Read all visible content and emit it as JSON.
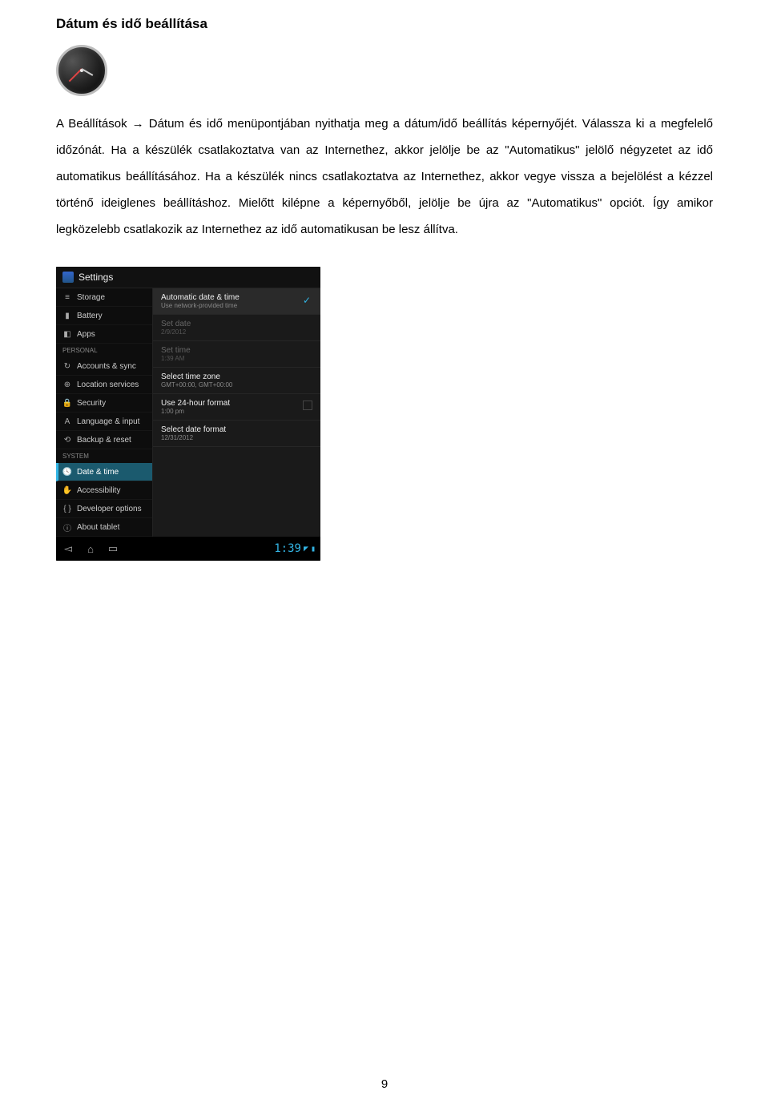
{
  "heading": "Dátum és idő beállítása",
  "body_text": "A Beállítások → Dátum és idő menüpontjában nyithatja meg a dátum/idő beállítás képernyőjét. Válassza ki a megfelelő időzónát. Ha a készülék csatlakoztatva van az Internethez, akkor jelölje be az \"Automatikus\" jelölő négyzetet az idő automatikus beállításához. Ha a készülék nincs csatlakoztatva az Internethez, akkor vegye vissza a bejelölést a kézzel történő ideiglenes beállításhoz. Mielőtt kilépne a képernyőből, jelölje be újra az \"Automatikus\" opciót. Így amikor legközelebb csatlakozik az Internethez az idő automatikusan be lesz állítva.",
  "page_number": "9",
  "screenshot": {
    "header_title": "Settings",
    "sidebar": {
      "items_top": [
        {
          "label": "Storage",
          "icon": "≡"
        },
        {
          "label": "Battery",
          "icon": "▮"
        },
        {
          "label": "Apps",
          "icon": "◧"
        }
      ],
      "section_personal": "PERSONAL",
      "items_personal": [
        {
          "label": "Accounts & sync",
          "icon": "↻"
        },
        {
          "label": "Location services",
          "icon": "⊕"
        },
        {
          "label": "Security",
          "icon": "🔒"
        },
        {
          "label": "Language & input",
          "icon": "A"
        },
        {
          "label": "Backup & reset",
          "icon": "⟲"
        }
      ],
      "section_system": "SYSTEM",
      "items_system": [
        {
          "label": "Date & time",
          "icon": "🕓"
        },
        {
          "label": "Accessibility",
          "icon": "✋"
        },
        {
          "label": "Developer options",
          "icon": "{ }"
        },
        {
          "label": "About tablet",
          "icon": "ⓘ"
        }
      ]
    },
    "panel": {
      "rows": [
        {
          "title": "Automatic date & time",
          "sub": "Use network-provided time",
          "checked": true,
          "highlight": true
        },
        {
          "title": "Set date",
          "sub": "2/9/2012",
          "disabled": true
        },
        {
          "title": "Set time",
          "sub": "1:39 AM",
          "disabled": true
        },
        {
          "title": "Select time zone",
          "sub": "GMT+00:00, GMT+00:00"
        },
        {
          "title": "Use 24-hour format",
          "sub": "1:00 pm",
          "checkbox_empty": true
        },
        {
          "title": "Select date format",
          "sub": "12/31/2012"
        }
      ]
    },
    "navbar": {
      "time": "1:39"
    }
  }
}
